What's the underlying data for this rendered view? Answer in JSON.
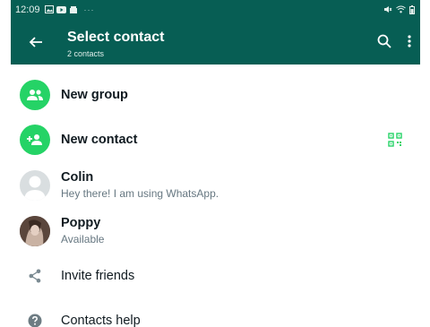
{
  "status_bar": {
    "time": "12:09",
    "icons": [
      "image-icon",
      "youtube-icon",
      "whatsapp-business-icon"
    ],
    "right_icons": [
      "mute-icon",
      "wifi-icon",
      "battery-icon"
    ]
  },
  "app_bar": {
    "title": "Select contact",
    "subtitle": "2 contacts",
    "background": "#075e54"
  },
  "actions": {
    "new_group": "New group",
    "new_contact": "New contact",
    "invite_friends": "Invite friends",
    "contacts_help": "Contacts help"
  },
  "contacts": [
    {
      "name": "Colin",
      "status": "Hey there! I am using WhatsApp."
    },
    {
      "name": "Poppy",
      "status": "Available"
    }
  ],
  "colors": {
    "accent_green": "#25d366",
    "primary_teal": "#075e54"
  }
}
